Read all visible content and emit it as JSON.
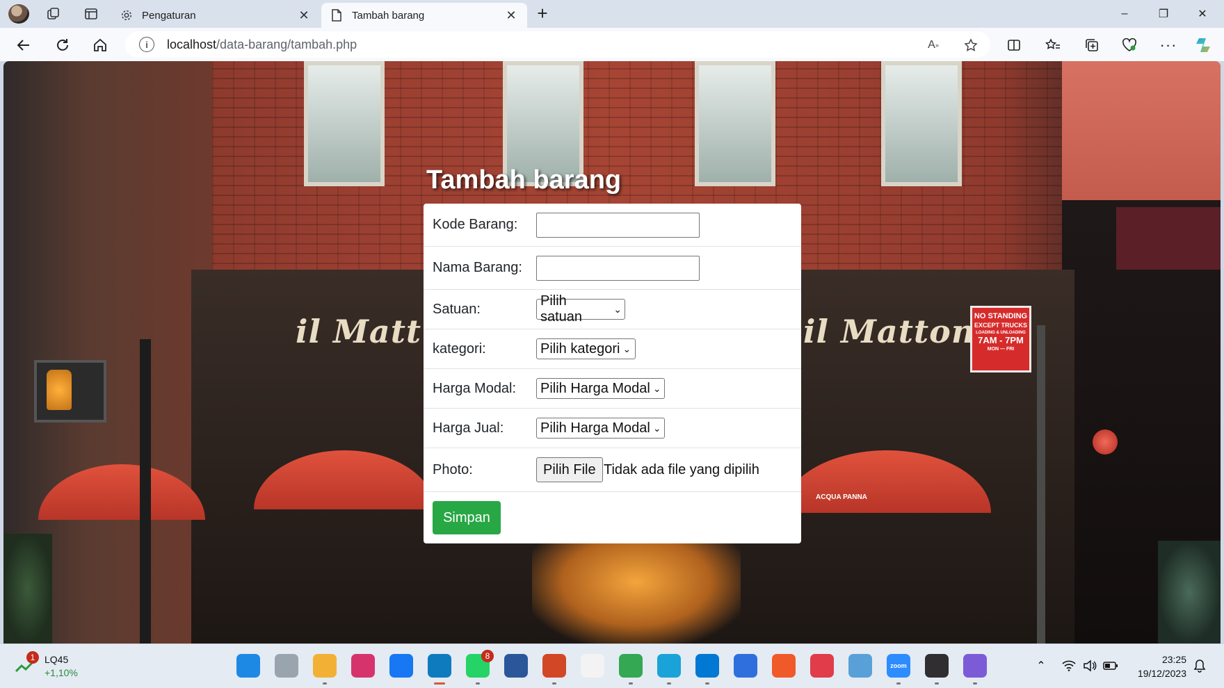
{
  "browser": {
    "tabs": [
      {
        "title": "Pengaturan",
        "icon": "gear-icon"
      },
      {
        "title": "Tambah barang",
        "icon": "page-icon",
        "active": true
      }
    ],
    "new_tab_symbol": "+",
    "url_host": "localhost",
    "url_path": "/data-barang/tambah.php",
    "window_controls": {
      "minimize": "–",
      "restore": "❐",
      "close": "✕"
    }
  },
  "page": {
    "heading": "Tambah barang",
    "form": {
      "kode_label": "Kode Barang:",
      "kode_value": "",
      "nama_label": "Nama Barang:",
      "nama_value": "",
      "satuan_label": "Satuan:",
      "satuan_selected": "Pilih satuan",
      "kategori_label": "kategori:",
      "kategori_selected": "Pilih kategori",
      "harga_modal_label": "Harga Modal:",
      "harga_modal_selected": "Pilih Harga Modal",
      "harga_jual_label": "Harga Jual:",
      "harga_jual_selected": "Pilih Harga Modal",
      "photo_label": "Photo:",
      "file_button": "Pilih File",
      "file_status": "Tidak ada file yang dipilih",
      "submit_label": "Simpan"
    },
    "background_signs": {
      "store_sign_left": "il Matt",
      "store_sign_right": "il Matton",
      "no_standing_line1": "NO STANDING",
      "no_standing_line2": "EXCEPT TRUCKS",
      "no_standing_line3": "LOADING & UNLOADING",
      "no_standing_line4": "7AM - 7PM",
      "no_standing_line5": "MON — FRI",
      "umbrella_text": "ACQUA PANNA"
    },
    "colors": {
      "submit": "#28a745",
      "card": "#ffffff",
      "heading": "#ffffff"
    }
  },
  "taskbar": {
    "stock_badge": "1",
    "stock_name": "LQ45",
    "stock_change": "+1,10%",
    "apps": [
      {
        "name": "windows-start",
        "color": "#1e88e5"
      },
      {
        "name": "task-view",
        "color": "#9aa4ae"
      },
      {
        "name": "file-explorer",
        "color": "#f2b134"
      },
      {
        "name": "instagram",
        "color": "#d6336c"
      },
      {
        "name": "facebook",
        "color": "#1877f2"
      },
      {
        "name": "edge",
        "color": "#0f7bbf"
      },
      {
        "name": "whatsapp",
        "color": "#25d366",
        "badge": "8"
      },
      {
        "name": "word",
        "color": "#2b579a"
      },
      {
        "name": "powerpoint",
        "color": "#d24726"
      },
      {
        "name": "microsoft-store",
        "color": "#f3f3f3"
      },
      {
        "name": "chrome",
        "color": "#34a853"
      },
      {
        "name": "mysql-workbench",
        "color": "#1aa3d8"
      },
      {
        "name": "vscode",
        "color": "#0078d4"
      },
      {
        "name": "app-a",
        "color": "#2f6fdd"
      },
      {
        "name": "sublime-swift",
        "color": "#f05a28"
      },
      {
        "name": "git-kraken",
        "color": "#e03c4a"
      },
      {
        "name": "virtualbox",
        "color": "#5aa0d8"
      },
      {
        "name": "zoom",
        "color": "#2d8cff",
        "label": "zoom"
      },
      {
        "name": "obs",
        "color": "#302e31"
      },
      {
        "name": "git-cola",
        "color": "#7b5cd6"
      }
    ],
    "time": "23:25",
    "date": "19/12/2023"
  }
}
